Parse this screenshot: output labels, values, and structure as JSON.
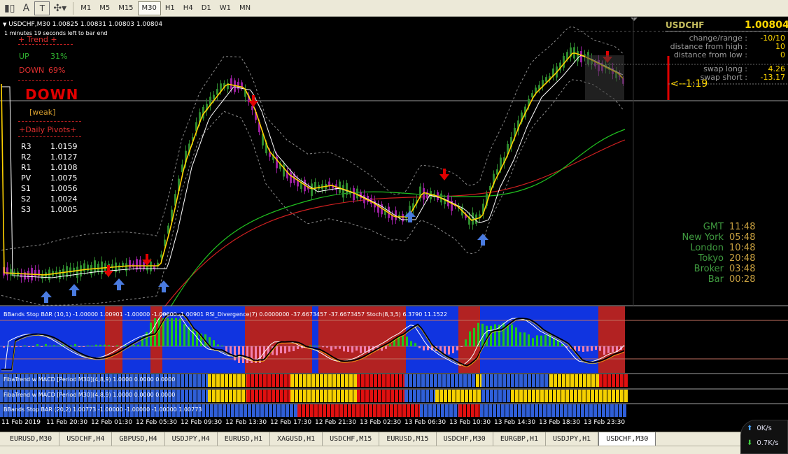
{
  "toolbar": {
    "icons": [
      "chart-candles-icon",
      "text-A-icon",
      "text-T-icon",
      "objects-icon"
    ],
    "glyphs": [
      "▮▯",
      "A",
      "T",
      "✣▾"
    ],
    "timeframes": [
      "M1",
      "M5",
      "M15",
      "M30",
      "H1",
      "H4",
      "D1",
      "W1",
      "MN"
    ],
    "active_timeframe": "M30"
  },
  "header": {
    "symbol_line": "USDCHF,M30  1.00825 1.00831 1.00803 1.00804",
    "bar_timer": "1 minutes 19 seconds left to bar end"
  },
  "trend_panel": {
    "title": "+   Trend   +",
    "up_label": "UP",
    "up_value": "31%",
    "down_label": "DOWN",
    "down_value": "69%",
    "verdict": "DOWN",
    "strength": "[weak]",
    "pivots_title": "+Daily Pivots+",
    "pivots": [
      {
        "label": "R3",
        "value": "1.0159"
      },
      {
        "label": "R2",
        "value": "1.0127"
      },
      {
        "label": "R1",
        "value": "1.0108"
      },
      {
        "label": "PV",
        "value": "1.0075"
      },
      {
        "label": "S1",
        "value": "1.0056"
      },
      {
        "label": "S2",
        "value": "1.0024"
      },
      {
        "label": "S3",
        "value": "1.0005"
      }
    ]
  },
  "info_panel": {
    "symbol": "USDCHF",
    "price": "1.00804",
    "rows": [
      {
        "label": "change/range :",
        "value": "-10/10"
      },
      {
        "label": "distance from high :",
        "value": "10"
      },
      {
        "label": "distance from low :",
        "value": "0"
      },
      {
        "label": "swap long :",
        "value": "4.26"
      },
      {
        "label": "swap short :",
        "value": "-13.17"
      }
    ],
    "ratio": "<--1:19"
  },
  "clocks": [
    {
      "label": "GMT",
      "time": "11:48"
    },
    {
      "label": "New York",
      "time": "05:48"
    },
    {
      "label": "London",
      "time": "10:48"
    },
    {
      "label": "Tokyo",
      "time": "20:48"
    },
    {
      "label": "Broker",
      "time": "03:48"
    },
    {
      "label": "Bar",
      "time": "00:28"
    }
  ],
  "indicators": {
    "sub1": "BBands Stop BAR (10,1) -1.00000  1.00901 -1.00000 -1.00000 -1.00901  RSI_Divergence(7) 0.0000000 -37.6673457 -37.6673457  Stoch(8,3,5) 6.3790 11.1522",
    "sub2": "FibaTrend w MACD [Period M30](4,8,9) 1.0000 0.0000 0.0000",
    "sub3": "FibaTrend w MACD [Period M30](4,8,9) 1.0000 0.0000 0.0000",
    "sub4": "BBands Stop BAR (20,2) 1.00773 -1.00000 -1.00000 -1.00000 1.00773"
  },
  "time_axis": [
    "11 Feb 2019",
    "11 Feb 20:30",
    "12 Feb 01:30",
    "12 Feb 05:30",
    "12 Feb 09:30",
    "12 Feb 13:30",
    "12 Feb 17:30",
    "12 Feb 21:30",
    "13 Feb 02:30",
    "13 Feb 06:30",
    "13 Feb 10:30",
    "13 Feb 14:30",
    "13 Feb 18:30",
    "13 Feb 23:30"
  ],
  "tabs": [
    "EURUSD,M30",
    "USDCHF,H4",
    "GBPUSD,H4",
    "USDJPY,H4",
    "EURUSD,H1",
    "XAGUSD,H1",
    "USDCHF,M15",
    "EURUSD,M15",
    "USDCHF,M30",
    "EURGBP,H1",
    "USDJPY,H1",
    "USDCHF,M30"
  ],
  "active_tab": 11,
  "network": {
    "up": "0K/s",
    "down": "0.7K/s"
  },
  "colors": {
    "bull": "#2e8b2e",
    "bear": "#9b1fa0",
    "band_red": "#b22222",
    "band_blue": "#1034e0",
    "yellow": "#ffd200",
    "info_yellow": "#ffd700",
    "clock_green": "#3f9a3f",
    "clock_gold": "#c8a040"
  }
}
